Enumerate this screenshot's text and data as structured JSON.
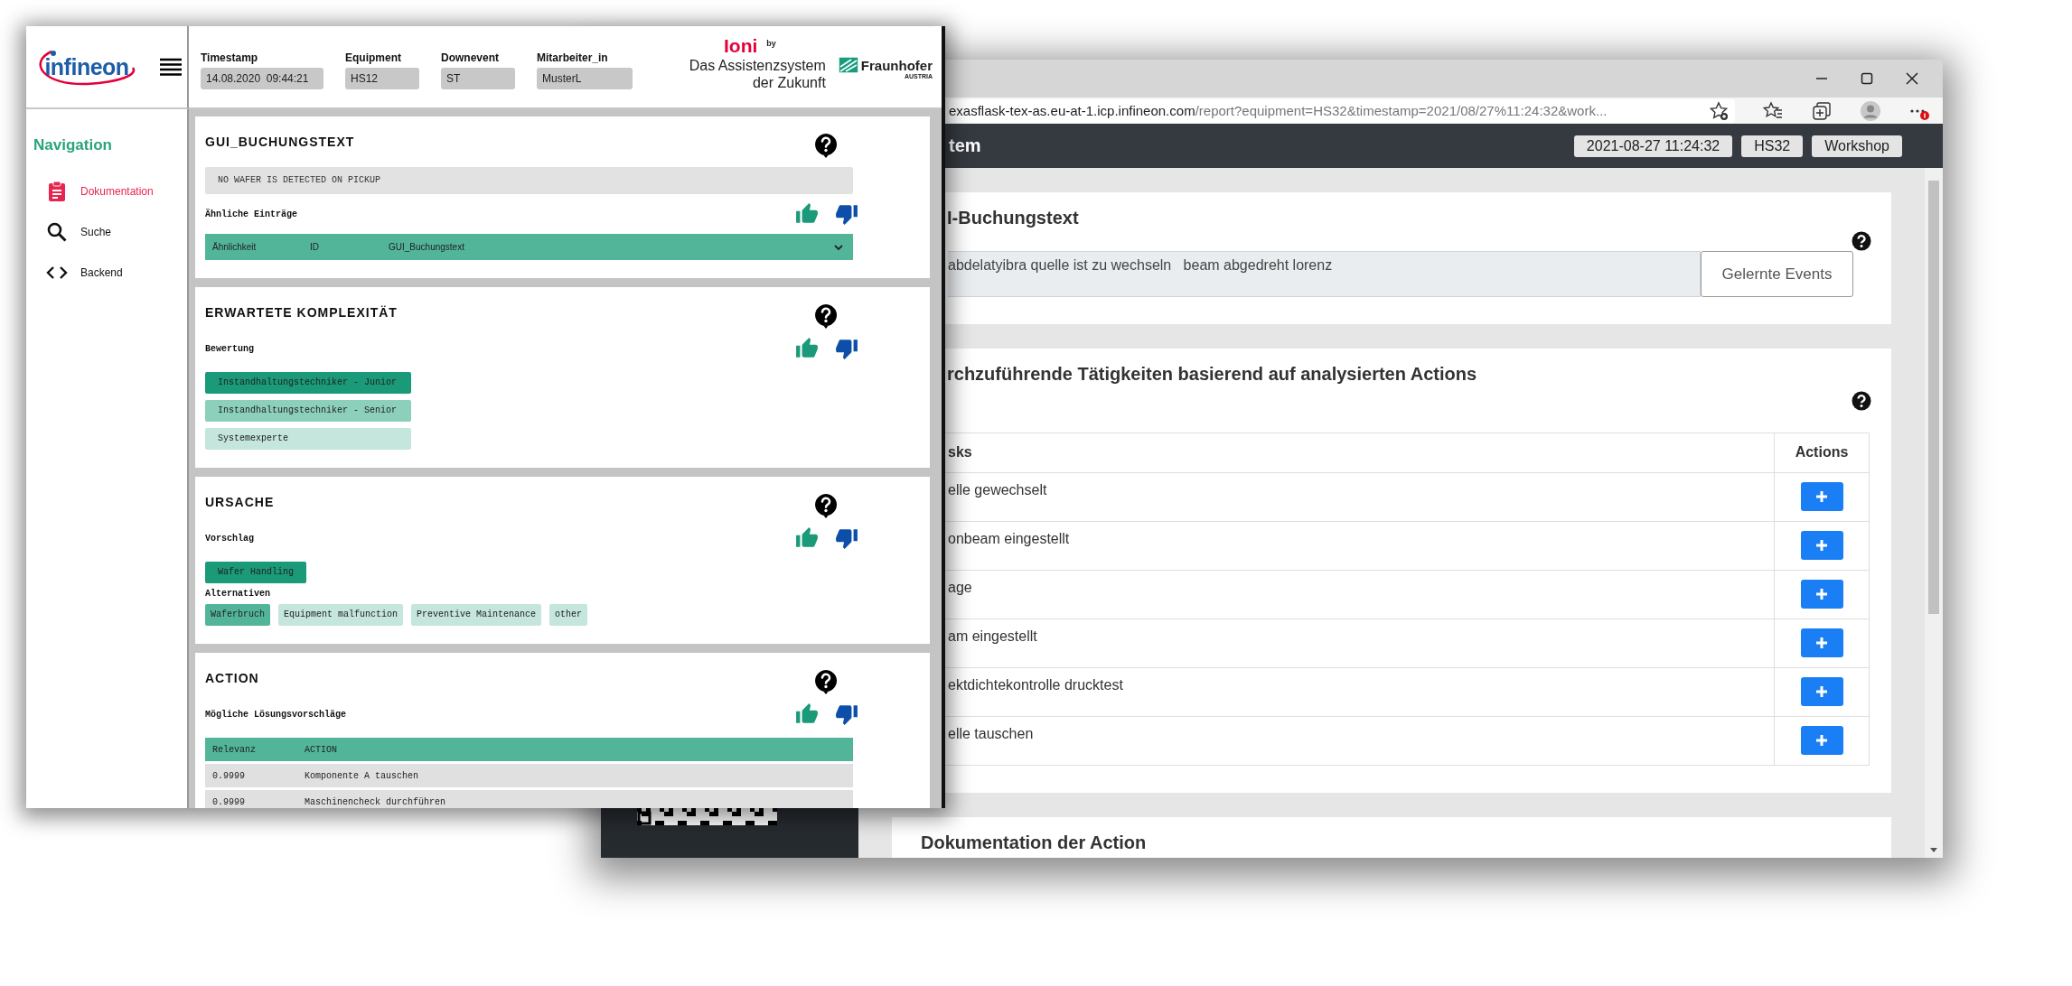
{
  "left_window": {
    "logo_text": "infineon",
    "header_fields": [
      {
        "label": "Timestamp",
        "value": "14.08.2020  09:44:21"
      },
      {
        "label": "Equipment",
        "value": "HS12"
      },
      {
        "label": "Downevent",
        "value": "ST"
      },
      {
        "label": "Mitarbeiter_in",
        "value": "MusterL"
      }
    ],
    "brand": {
      "name": "Ioni",
      "by": "by",
      "tagline": [
        "Das Assistenzsystem",
        "der Zukunft"
      ],
      "partner": "Fraunhofer",
      "partner_country": "AUSTRIA"
    },
    "navigation": {
      "title": "Navigation",
      "items": [
        {
          "label": "Dokumentation",
          "selected": true
        },
        {
          "label": "Suche",
          "selected": false
        },
        {
          "label": "Backend",
          "selected": false
        }
      ]
    },
    "cards": [
      {
        "kind": "text",
        "title": "GUI_BUCHUNGSTEXT",
        "text": "NO WAFER IS DETECTED ON PICKUP",
        "subtitle": "Ähnliche Einträge",
        "dropdown_columns": [
          "Ähnlichkeit",
          "ID",
          "GUI_Buchungstext"
        ]
      },
      {
        "kind": "rating",
        "title": "ERWARTETE KOMPLEXITÄT",
        "subtitle": "Bewertung",
        "options": [
          {
            "label": "Instandhaltungstechniker - Junior",
            "color": "#1a9a78"
          },
          {
            "label": "Instandhaltungstechniker - Senior",
            "color": "#8ccfbb"
          },
          {
            "label": "Systemexperte",
            "color": "#c4e6dc"
          }
        ]
      },
      {
        "kind": "cause",
        "title": "URSACHE",
        "subtitle": "Vorschlag",
        "suggestion": {
          "label": "Wafer Handling",
          "color": "#1a9a78"
        },
        "alternatives_label": "Alternativen",
        "alternatives": [
          {
            "label": "Waferbruch",
            "color": "#52b59a"
          },
          {
            "label": "Equipment malfunction",
            "color": "#c4e6dc"
          },
          {
            "label": "Preventive Maintenance",
            "color": "#c4e6dc"
          },
          {
            "label": "other",
            "color": "#c4e6dc"
          }
        ]
      },
      {
        "kind": "table",
        "title": "ACTION",
        "subtitle": "Mögliche Lösungsvorschläge",
        "columns": [
          "Relevanz",
          "ACTION"
        ],
        "rows": [
          [
            "0.9999",
            "Komponente A tauschen"
          ],
          [
            "0.9999",
            "Maschinencheck durchführen"
          ]
        ]
      }
    ]
  },
  "right_window": {
    "url_host": "exasflask-tex-as.eu-at-1.icp.infineon.com",
    "url_path": "/report?equipment=HS32&timestamp=2021/08/27%11:24:32&work...",
    "app_title": "tem",
    "header_buttons": [
      "2021-08-27 11:24:32",
      "HS32",
      "Workshop"
    ],
    "sections": [
      {
        "kind": "text",
        "title": "I-Buchungstext",
        "text": "abdelatyibra quelle ist zu wechseln   beam abgedreht lorenz",
        "button": "Gelernte Events"
      },
      {
        "kind": "table",
        "title": "rchzuführende Tätigkeiten basierend auf analysierten Actions",
        "columns": [
          "sks",
          "Actions"
        ],
        "rows": [
          "elle gewechselt",
          "onbeam eingestellt",
          "age",
          "am eingestellt",
          "ektdichtekontrolle drucktest",
          "elle tauschen"
        ]
      },
      {
        "kind": "heading",
        "title": "Dokumentation der Action"
      }
    ]
  }
}
